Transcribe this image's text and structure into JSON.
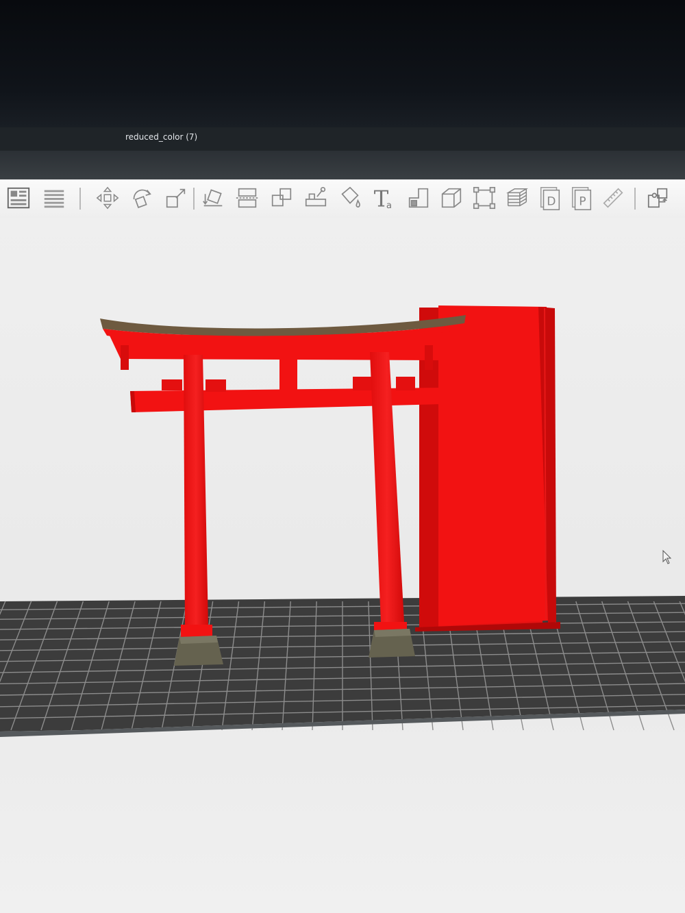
{
  "window": {
    "title": "reduced_color (7)"
  },
  "toolbar": {
    "tools": [
      {
        "icon": "layout-panel-icon"
      },
      {
        "icon": "objects-list-icon"
      },
      {
        "icon": "move-icon"
      },
      {
        "icon": "rotate-icon"
      },
      {
        "icon": "scale-icon"
      },
      {
        "icon": "lay-on-face-icon"
      },
      {
        "icon": "cut-icon"
      },
      {
        "icon": "arrange-icon"
      },
      {
        "icon": "support-paint-icon"
      },
      {
        "icon": "color-paint-icon"
      },
      {
        "icon": "text-icon",
        "label": "T",
        "sublabel": "a"
      },
      {
        "icon": "seam-paint-icon"
      },
      {
        "icon": "add-cube-icon"
      },
      {
        "icon": "boundary-box-icon"
      },
      {
        "icon": "slice-layers-icon"
      },
      {
        "icon": "plate-d-icon",
        "label": "D"
      },
      {
        "icon": "plate-p-icon",
        "label": "P"
      },
      {
        "icon": "measure-ruler-icon"
      },
      {
        "icon": "assembly-puzzle-icon"
      }
    ]
  },
  "scene": {
    "model_color": "#f21212",
    "model_shadow_color": "#c40a0a",
    "roof_color": "#6e5a40",
    "base_color": "#65624f",
    "plate_color": "#3c3c3c",
    "plate_grid_color": "#8d8d8d",
    "background_color": "#ececec"
  }
}
